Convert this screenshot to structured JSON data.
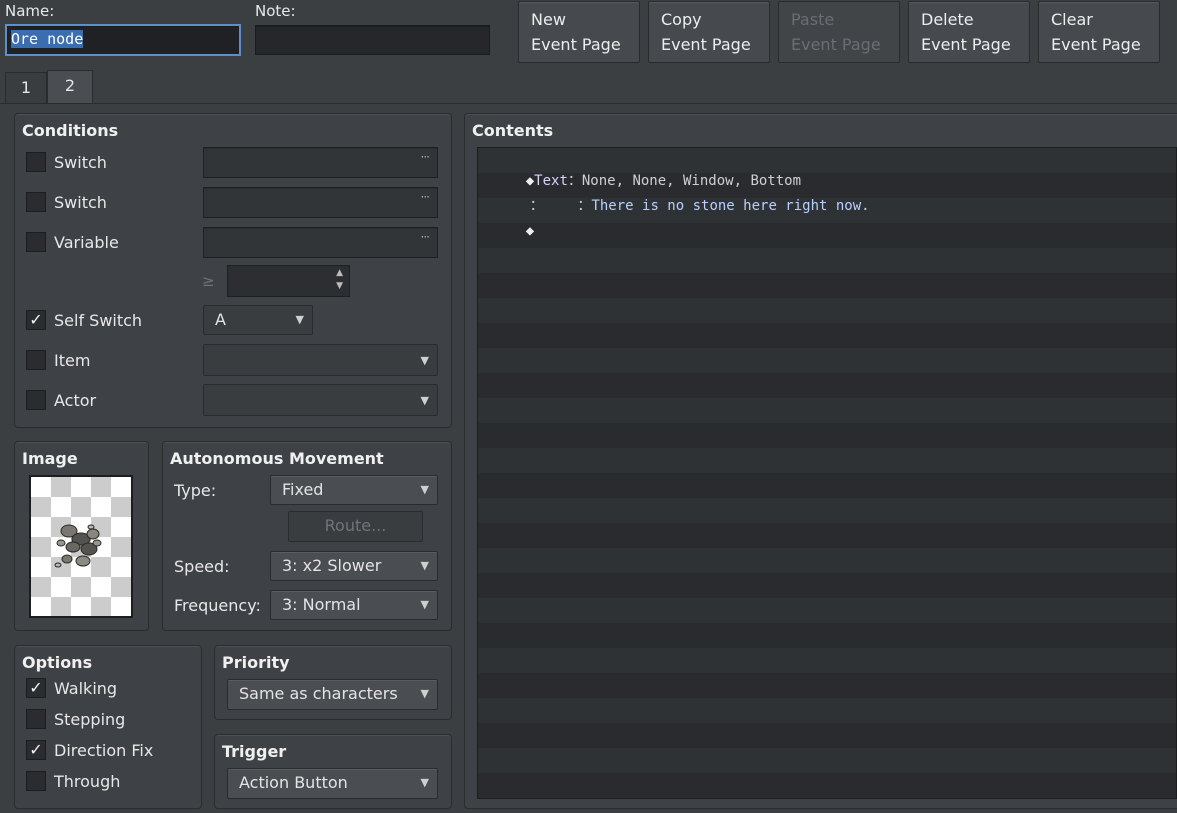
{
  "header": {
    "name_label": "Name:",
    "name_value": "Ore node",
    "note_label": "Note:",
    "note_value": ""
  },
  "toolbar": {
    "new_line1": "New",
    "new_line2": "Event Page",
    "copy_line1": "Copy",
    "copy_line2": "Event Page",
    "paste_line1": "Paste",
    "paste_line2": "Event Page",
    "delete_line1": "Delete",
    "delete_line2": "Event Page",
    "clear_line1": "Clear",
    "clear_line2": "Event Page"
  },
  "tabs": [
    {
      "label": "1",
      "active": false
    },
    {
      "label": "2",
      "active": true
    }
  ],
  "conditions": {
    "title": "Conditions",
    "switch1_label": "Switch",
    "switch1_checked": false,
    "switch2_label": "Switch",
    "switch2_checked": false,
    "variable_label": "Variable",
    "variable_checked": false,
    "gte_symbol": "≥",
    "self_switch_label": "Self Switch",
    "self_switch_checked": true,
    "self_switch_value": "A",
    "item_label": "Item",
    "item_checked": false,
    "actor_label": "Actor",
    "actor_checked": false,
    "dots": "···"
  },
  "image": {
    "title": "Image"
  },
  "movement": {
    "title": "Autonomous Movement",
    "type_label": "Type:",
    "type_value": "Fixed",
    "route_button": "Route...",
    "speed_label": "Speed:",
    "speed_value": "3: x2 Slower",
    "frequency_label": "Frequency:",
    "frequency_value": "3: Normal"
  },
  "options": {
    "title": "Options",
    "walking_label": "Walking",
    "walking_checked": true,
    "stepping_label": "Stepping",
    "stepping_checked": false,
    "direction_fix_label": "Direction Fix",
    "direction_fix_checked": true,
    "through_label": "Through",
    "through_checked": false
  },
  "priority": {
    "title": "Priority",
    "value": "Same as characters"
  },
  "trigger": {
    "title": "Trigger",
    "value": "Action Button"
  },
  "contents": {
    "title": "Contents",
    "lines": [
      {
        "marker": "◆",
        "command": "Text",
        "sep": "：",
        "text": "None, None, Window, Bottom"
      },
      {
        "marker": "：",
        "command": "",
        "sep": "    ：",
        "text": "There is no stone here right now."
      },
      {
        "marker": "◆",
        "command": "",
        "sep": "",
        "text": ""
      }
    ]
  },
  "check_mark": "✓",
  "arrow_glyph": "▼",
  "spin_up": "▲",
  "spin_down": "▼"
}
